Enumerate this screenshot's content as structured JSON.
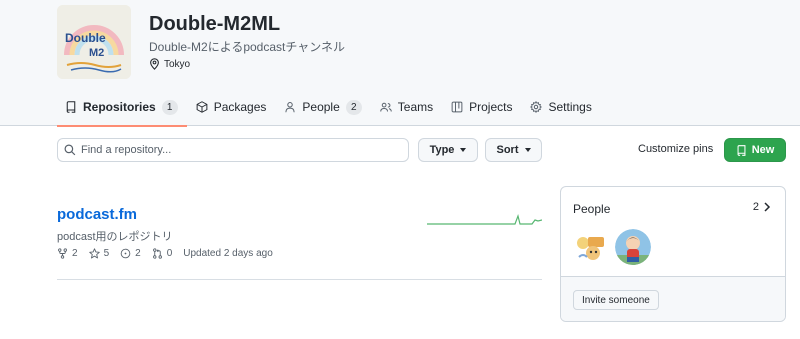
{
  "org": {
    "name": "Double-M2ML",
    "description": "Double-M2によるpodcastチャンネル",
    "location": "Tokyo",
    "logo_text": "Double M2",
    "logo_arc_text": "MATCHING LEARNING"
  },
  "tabs": [
    {
      "label": "Repositories",
      "count": "1",
      "icon": "repo-icon",
      "active": true
    },
    {
      "label": "Packages",
      "icon": "package-icon"
    },
    {
      "label": "People",
      "count": "2",
      "icon": "person-icon"
    },
    {
      "label": "Teams",
      "icon": "people-icon"
    },
    {
      "label": "Projects",
      "icon": "table-icon"
    },
    {
      "label": "Settings",
      "icon": "gear-icon"
    }
  ],
  "toolbar": {
    "search_placeholder": "Find a repository...",
    "type_label": "Type",
    "sort_label": "Sort",
    "customize_label": "Customize pins",
    "new_label": "New"
  },
  "repo": {
    "name": "podcast.fm",
    "description": "podcast用のレポジトリ",
    "forks": "2",
    "stars": "5",
    "issues": "2",
    "pulls": "0",
    "updated": "Updated 2 days ago"
  },
  "people": {
    "title": "People",
    "count": "2",
    "invite_label": "Invite someone"
  },
  "colors": {
    "accent_tab": "#fd8c73",
    "link": "#0969da",
    "new_button": "#2da44e",
    "sparkline": "#2da44e"
  }
}
